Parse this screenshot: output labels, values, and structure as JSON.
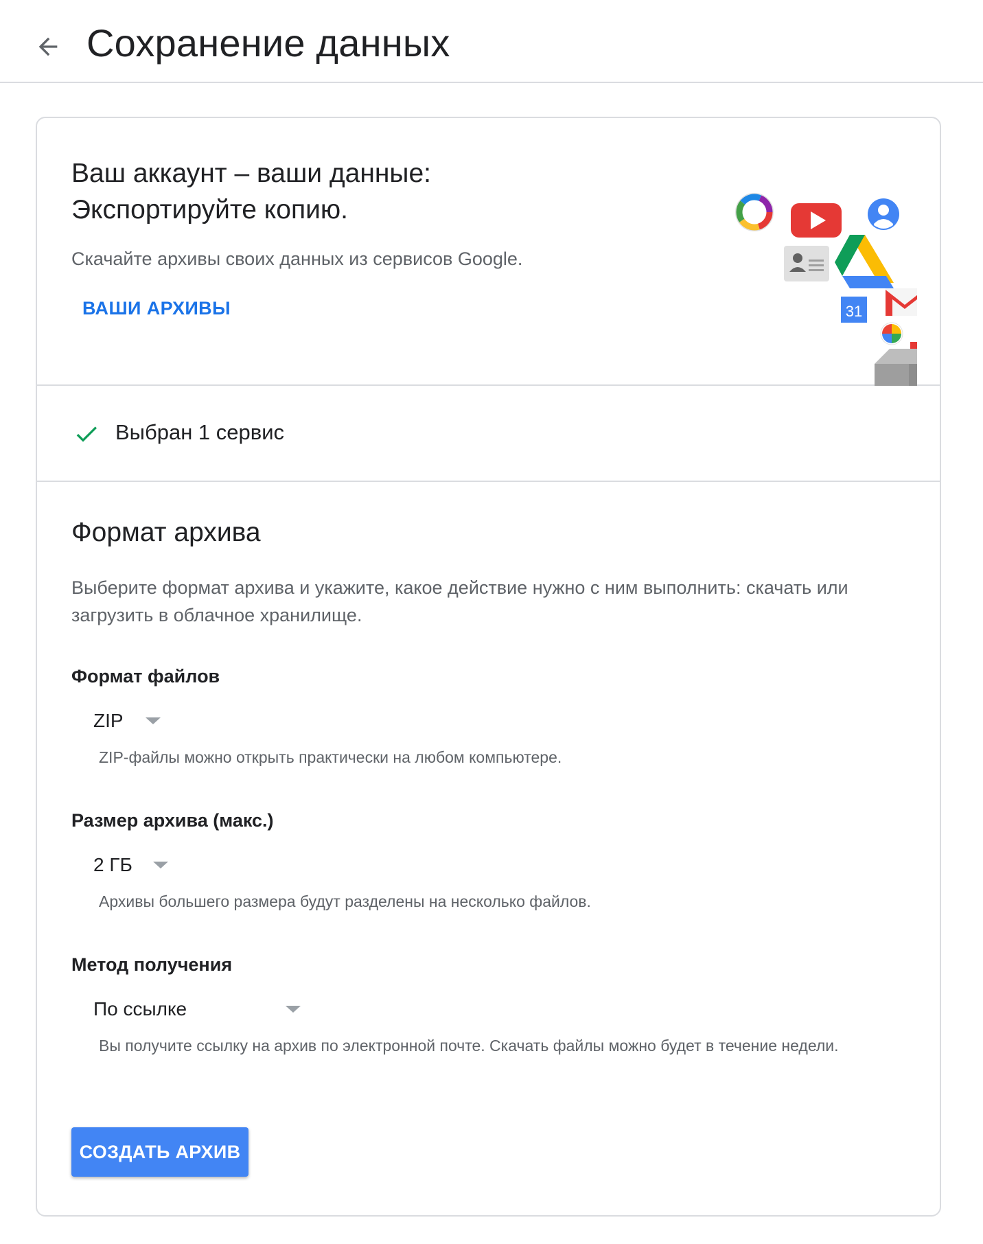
{
  "header": {
    "back_icon": "arrow-back-icon",
    "title": "Сохранение данных"
  },
  "hero": {
    "title_line1": "Ваш аккаунт – ваши данные:",
    "title_line2": "Экспортируйте копию.",
    "description": "Скачайте архивы своих данных из сервисов Google.",
    "archives_link": "ВАШИ АРХИВЫ",
    "illustration_icons": [
      "picasa-icon",
      "youtube-icon",
      "profile-icon",
      "contacts-icon",
      "drive-icon",
      "calendar-icon",
      "gmail-icon",
      "hangouts-icon",
      "rss-icon",
      "box-icon"
    ],
    "calendar_day": "31"
  },
  "selected_services": {
    "icon": "check-icon",
    "text": "Выбран 1 сервис"
  },
  "archive_format": {
    "title": "Формат архива",
    "description": "Выберите формат архива и укажите, какое действие нужно с ним выполнить: скачать или загрузить в облачное хранилище.",
    "file_type": {
      "label": "Формат файлов",
      "value": "ZIP",
      "hint": "ZIP-файлы можно открыть практически на любом компьютере."
    },
    "archive_size": {
      "label": "Размер архива (макс.)",
      "value": "2 ГБ",
      "hint": "Архивы большего размера будут разделены на несколько файлов."
    },
    "delivery_method": {
      "label": "Метод получения",
      "value": "По ссылке",
      "hint": "Вы получите ссылку на архив по электронной почте. Скачать файлы можно будет в течение недели."
    },
    "create_button": "СОЗДАТЬ АРХИВ"
  },
  "colors": {
    "accent_blue": "#4285f4",
    "link_blue": "#1a73e8",
    "check_green": "#0f9d58",
    "divider": "#dadce0"
  }
}
